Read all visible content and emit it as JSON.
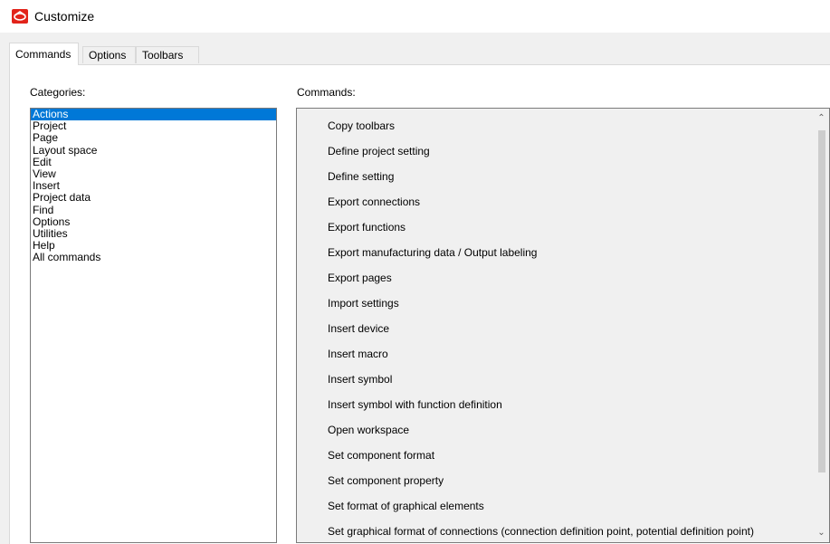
{
  "window": {
    "title": "Customize",
    "icon": "app-logo-icon",
    "accent": "#e2231a"
  },
  "tabs": [
    {
      "label": "Commands",
      "active": true
    },
    {
      "label": "Options",
      "active": false
    },
    {
      "label": "Toolbars",
      "active": false
    }
  ],
  "categories": {
    "label": "Categories:",
    "selected": "Actions",
    "items": [
      "Actions",
      "Project",
      "Page",
      "Layout space",
      "Edit",
      "View",
      "Insert",
      "Project data",
      "Find",
      "Options",
      "Utilities",
      "Help",
      "All commands"
    ]
  },
  "commands": {
    "label": "Commands:",
    "items": [
      "Copy toolbars",
      "Define project setting",
      "Define setting",
      "Export connections",
      "Export functions",
      "Export manufacturing data / Output labeling",
      "Export pages",
      "Import settings",
      "Insert device",
      "Insert macro",
      "Insert symbol",
      "Insert symbol with function definition",
      "Open workspace",
      "Set component format",
      "Set component property",
      "Set format of graphical elements",
      "Set graphical format of connections (connection definition point, potential definition point)"
    ]
  },
  "colors": {
    "selection": "#0078d7",
    "window_bg": "#f0f0f0"
  }
}
